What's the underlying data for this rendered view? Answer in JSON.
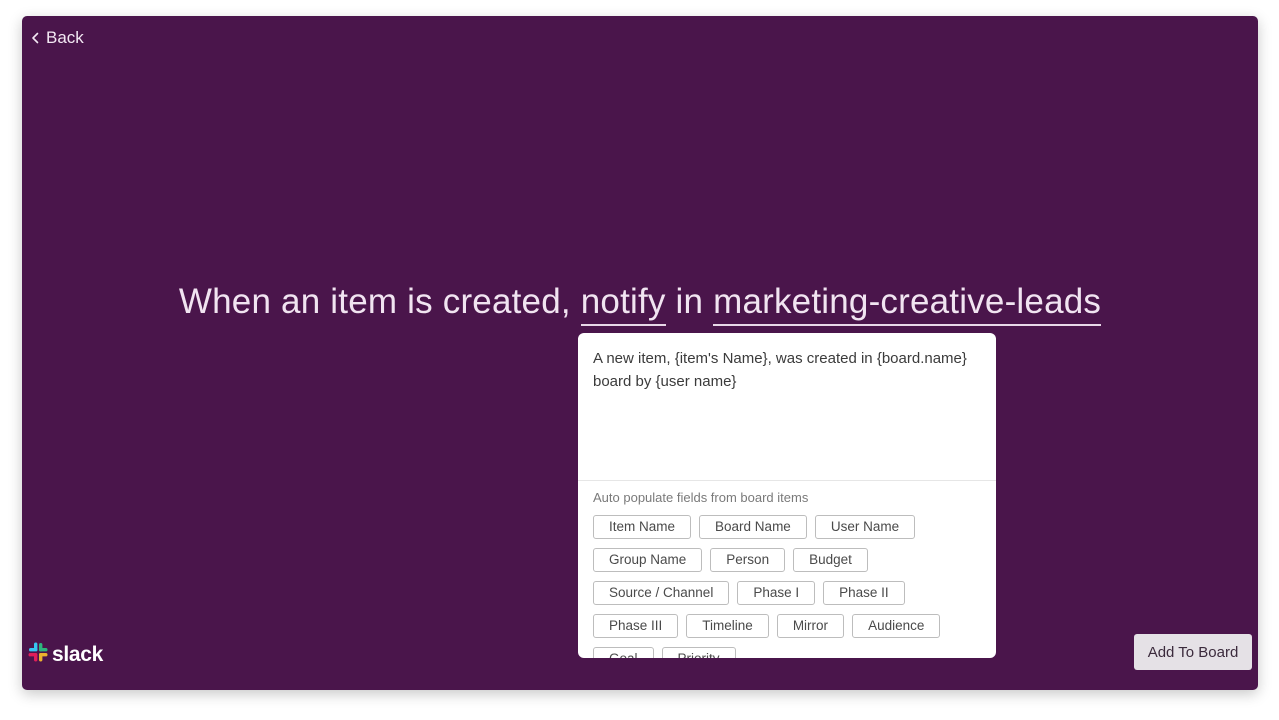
{
  "nav": {
    "back_label": "Back"
  },
  "headline": {
    "prefix": "When an item is created, ",
    "action": "notify",
    "connector": " in ",
    "channel": "marketing-creative-leads"
  },
  "card": {
    "message": "A new item, {item's Name}, was created in {board.name} board by {user name}",
    "auto_populate_label": "Auto populate fields from board items",
    "chip_rows": [
      [
        "Item Name",
        "Board Name",
        "User Name"
      ],
      [
        "Group Name",
        "Person",
        "Budget"
      ],
      [
        "Source / Channel",
        "Phase I",
        "Phase II"
      ],
      [
        "Phase III",
        "Timeline",
        "Mirror",
        "Audience"
      ],
      [
        "Goal",
        "Priority"
      ]
    ]
  },
  "brand": {
    "name": "slack"
  },
  "actions": {
    "add_to_board_label": "Add To Board"
  },
  "colors": {
    "background": "#4a154b",
    "card": "#ffffff",
    "button": "#e5e1e6"
  },
  "icons": {
    "back": "chevron-left-icon",
    "logo": "slack-logo-icon"
  }
}
